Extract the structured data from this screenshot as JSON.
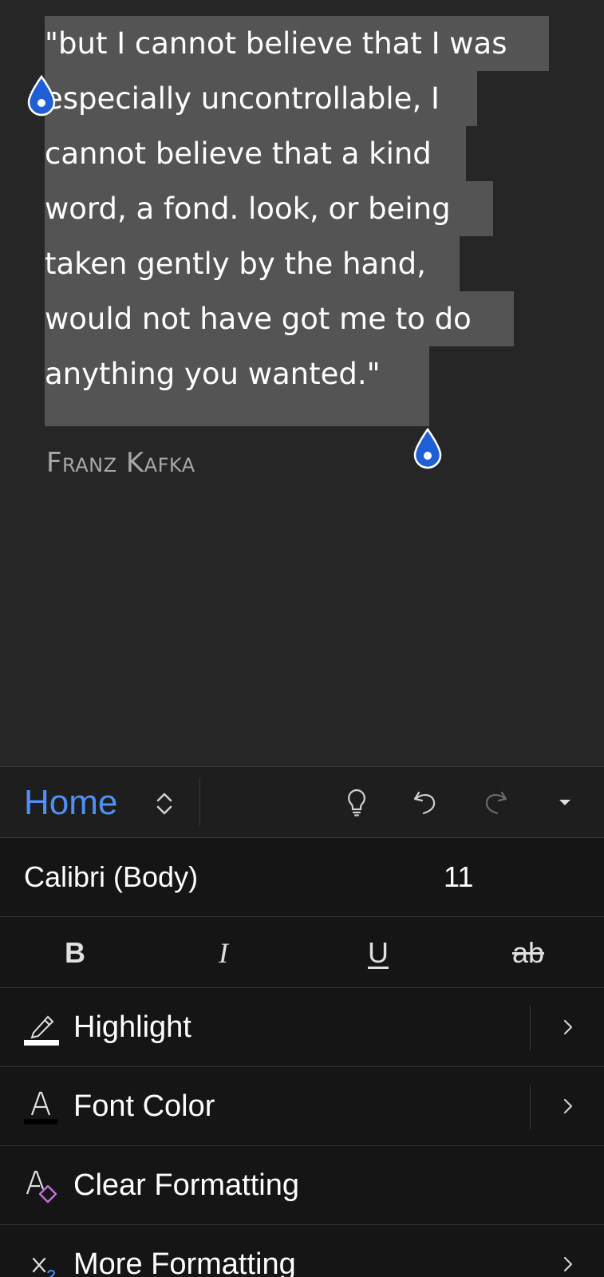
{
  "document": {
    "quote_lines": [
      "\"but I cannot believe that I was",
      "especially uncontrollable, I",
      "cannot believe that a kind",
      "word, a fond. look, or being",
      "taken gently by the hand,",
      "would not have got me to do",
      "anything you wanted.\""
    ],
    "author": "Franz Kafka"
  },
  "ribbon": {
    "tab_label": "Home",
    "font": {
      "name": "Calibri (Body)",
      "size": "11"
    },
    "styles": {
      "bold": "B",
      "italic": "I",
      "underline": "U",
      "strikethrough": "ab"
    },
    "menu": [
      {
        "label": "Highlight",
        "icon": "highlighter-icon",
        "has_chevron": true
      },
      {
        "label": "Font Color",
        "icon": "font-color-icon",
        "has_chevron": true
      },
      {
        "label": "Clear Formatting",
        "icon": "clear-formatting-icon",
        "has_chevron": false
      },
      {
        "label": "More Formatting",
        "icon": "subscript-icon",
        "has_chevron": true
      }
    ]
  },
  "colors": {
    "accent": "#4f8ff7",
    "selection": "#545454",
    "selection_handle": "#1f5fd6",
    "highlight_swatch": "#ffffff",
    "font_color_swatch": "#000000",
    "clear_formatting_accent": "#c86dd7"
  }
}
